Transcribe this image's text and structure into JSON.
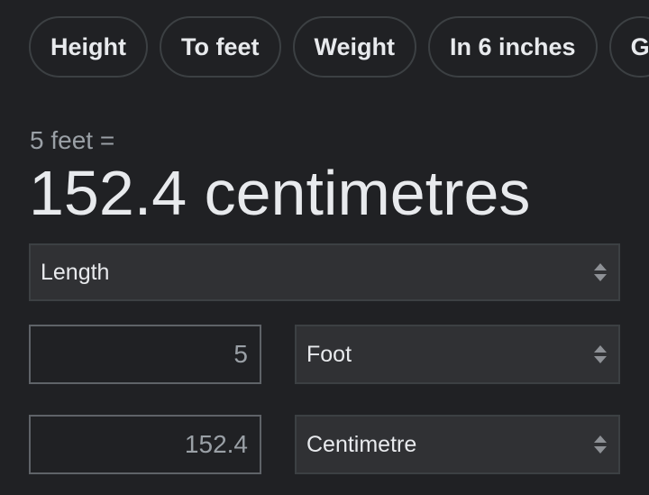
{
  "chips": [
    {
      "label": "Height"
    },
    {
      "label": "To feet"
    },
    {
      "label": "Weight"
    },
    {
      "label": "In 6 inches"
    },
    {
      "label": "G"
    }
  ],
  "equation": {
    "lhs": "5 feet =",
    "rhs": "152.4 centimetres"
  },
  "converter": {
    "category": "Length",
    "from": {
      "value": "5",
      "unit": "Foot"
    },
    "to": {
      "value": "152.4",
      "unit": "Centimetre"
    }
  },
  "icons": {
    "select_arrows": "up-down-caret-icon"
  }
}
